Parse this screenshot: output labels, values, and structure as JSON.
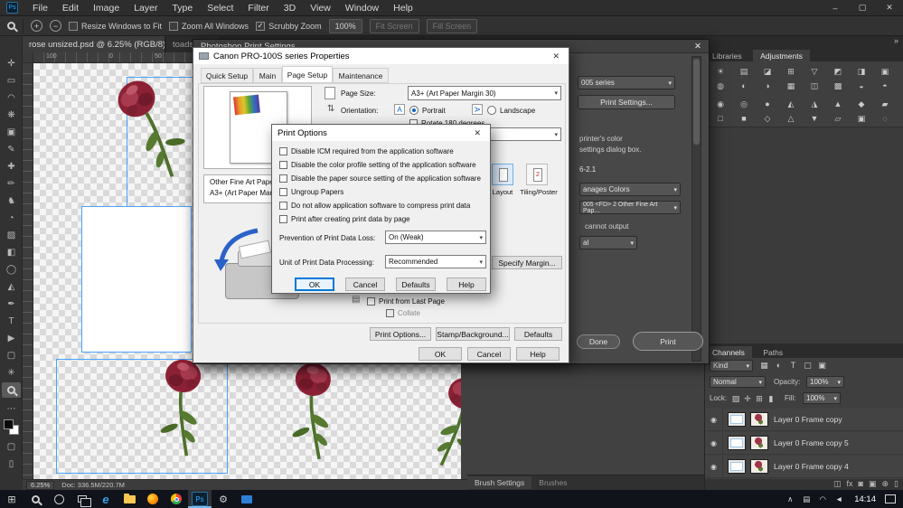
{
  "menubar": {
    "logo": "Ps",
    "items": [
      "File",
      "Edit",
      "Image",
      "Layer",
      "Type",
      "Select",
      "Filter",
      "3D",
      "View",
      "Window",
      "Help"
    ],
    "minimize": "–",
    "maximize": "▢",
    "close": "✕"
  },
  "options_bar": {
    "resize_windows": "Resize Windows to Fit",
    "zoom_all": "Zoom All Windows",
    "scrubby": "Scrubby Zoom",
    "zoom_value": "100%",
    "fit_screen": "Fit Screen",
    "fill_screen": "Fill Screen"
  },
  "doc_tabs": {
    "active_title": "rose unsized.psd @ 6.25% (RGB/8)",
    "active_close": "✕",
    "second_title": "toadsto..."
  },
  "ruler": {
    "marks": [
      "100",
      "0",
      "50"
    ]
  },
  "ps_print_dialog": {
    "title": "Photoshop Print Settings",
    "close": "✕",
    "printer_select": "005 series",
    "print_settings_button": "Print Settings...",
    "desc_line1": "printer's color",
    "desc_line2": "settings dialog box.",
    "figure_ref": "6-2.1",
    "color_handling": "anages Colors",
    "printer_profile": "005 <FD> 2 Other Fine Art Pap...",
    "note": "cannot output",
    "rendering_intent": "al",
    "done_button": "Done",
    "print_button": "Print"
  },
  "canon_dialog": {
    "title": "Canon PRO-100S series Properties",
    "close": "✕",
    "tabs": [
      "Quick Setup",
      "Main",
      "Page Setup",
      "Maintenance"
    ],
    "page_size_label": "Page Size:",
    "page_size_value": "A3+ (Art Paper Margin 30)",
    "orientation_label": "Orientation:",
    "portrait_label": "Portrait",
    "landscape_label": "Landscape",
    "rotate_label": "Rotate 180 degrees",
    "media_type": "Other Fine Art Paper",
    "media_size": "A3+ (Art Paper Margi...",
    "layout_label": "Layout",
    "tiling_label": "Tiling/Poster",
    "tiling_badge": "2",
    "specify_margin_button": "Specify Margin...",
    "print_last_label": "Print from Last Page",
    "collate_label": "Collate",
    "print_options_button": "Print Options...",
    "stamp_button": "Stamp/Background...",
    "defaults_button": "Defaults",
    "ok": "OK",
    "cancel": "Cancel",
    "help": "Help"
  },
  "print_options_dialog": {
    "title": "Print Options",
    "close": "✕",
    "checkboxes": [
      "Disable ICM required from the application software",
      "Disable the color profile setting of the application software",
      "Disable the paper source setting of the application software",
      "Ungroup Papers",
      "Do not allow application software to compress print data",
      "Print after creating print data by page"
    ],
    "prevention_label": "Prevention of Print Data Loss:",
    "prevention_value": "On (Weak)",
    "unit_label": "Unit of Print Data Processing:",
    "unit_value": "Recommended",
    "ok": "OK",
    "cancel": "Cancel",
    "defaults": "Defaults",
    "help": "Help"
  },
  "right_panels": {
    "libraries_tab": "Libraries",
    "adjustments_tab": "Adjustments",
    "channels_tab": "Channels",
    "paths_tab": "Paths",
    "kind": "Kind",
    "blend_mode": "Normal",
    "opacity_label": "Opacity:",
    "opacity_value": "100%",
    "lock_label": "Lock:",
    "fill_label": "Fill:",
    "fill_value": "100%",
    "layers": [
      {
        "name": "Layer 0 Frame copy"
      },
      {
        "name": "Layer 0 Frame copy 5"
      },
      {
        "name": "Layer 0 Frame copy 4"
      }
    ],
    "brush_settings_tab": "Brush Settings",
    "brushes_tab": "Brushes"
  },
  "status_bar": {
    "zoom": "6.25%",
    "doc_info": "Doc: 336.5M/220.7M"
  },
  "taskbar": {
    "ps_label": "Ps",
    "edge_label": "e",
    "clock": "14:14"
  },
  "icons": {
    "check": "✓",
    "caret": "▾",
    "collapse": "»",
    "tools": [
      "✛",
      "▭",
      "◠",
      "❋",
      "▣",
      "✎",
      "✚",
      "✏",
      "♞",
      "◔",
      "▨",
      "◧",
      "◯",
      "◭",
      "✒",
      "T",
      "▶",
      "▢",
      "✳"
    ],
    "ellipsis": "⋯",
    "quick_mask": "▢",
    "screen_mode": "▯",
    "adjustment_rows": [
      [
        "☀",
        "▤",
        "◪",
        "⊞",
        "▽",
        "◩",
        "◨",
        "▣"
      ],
      [
        "◍",
        "◐",
        "◑",
        "▦",
        "◫",
        "▩",
        "◒",
        "◓"
      ],
      [
        "◉",
        "◎",
        "●",
        "◭",
        "◮",
        "▲",
        "◆",
        "▰"
      ],
      [
        "□",
        "■",
        "◇",
        "△",
        "▼",
        "▱",
        "▣",
        "◌"
      ]
    ],
    "layer_filters": [
      "▦",
      "◐",
      "T",
      "▢",
      "▣"
    ],
    "lock_icons": [
      "▨",
      "✛",
      "⊞",
      "▮"
    ],
    "eye": "◉",
    "panel_footer": [
      "◫",
      "fx",
      "◙",
      "▣",
      "⊕",
      "▯"
    ],
    "start": "⊞",
    "gear": "⚙",
    "chevron": "∧",
    "tray": [
      "▤",
      "◠",
      "◄"
    ],
    "portrait_a": "A",
    "landscape_a": "A",
    "zoom_plus": "+",
    "zoom_minus": "−"
  }
}
